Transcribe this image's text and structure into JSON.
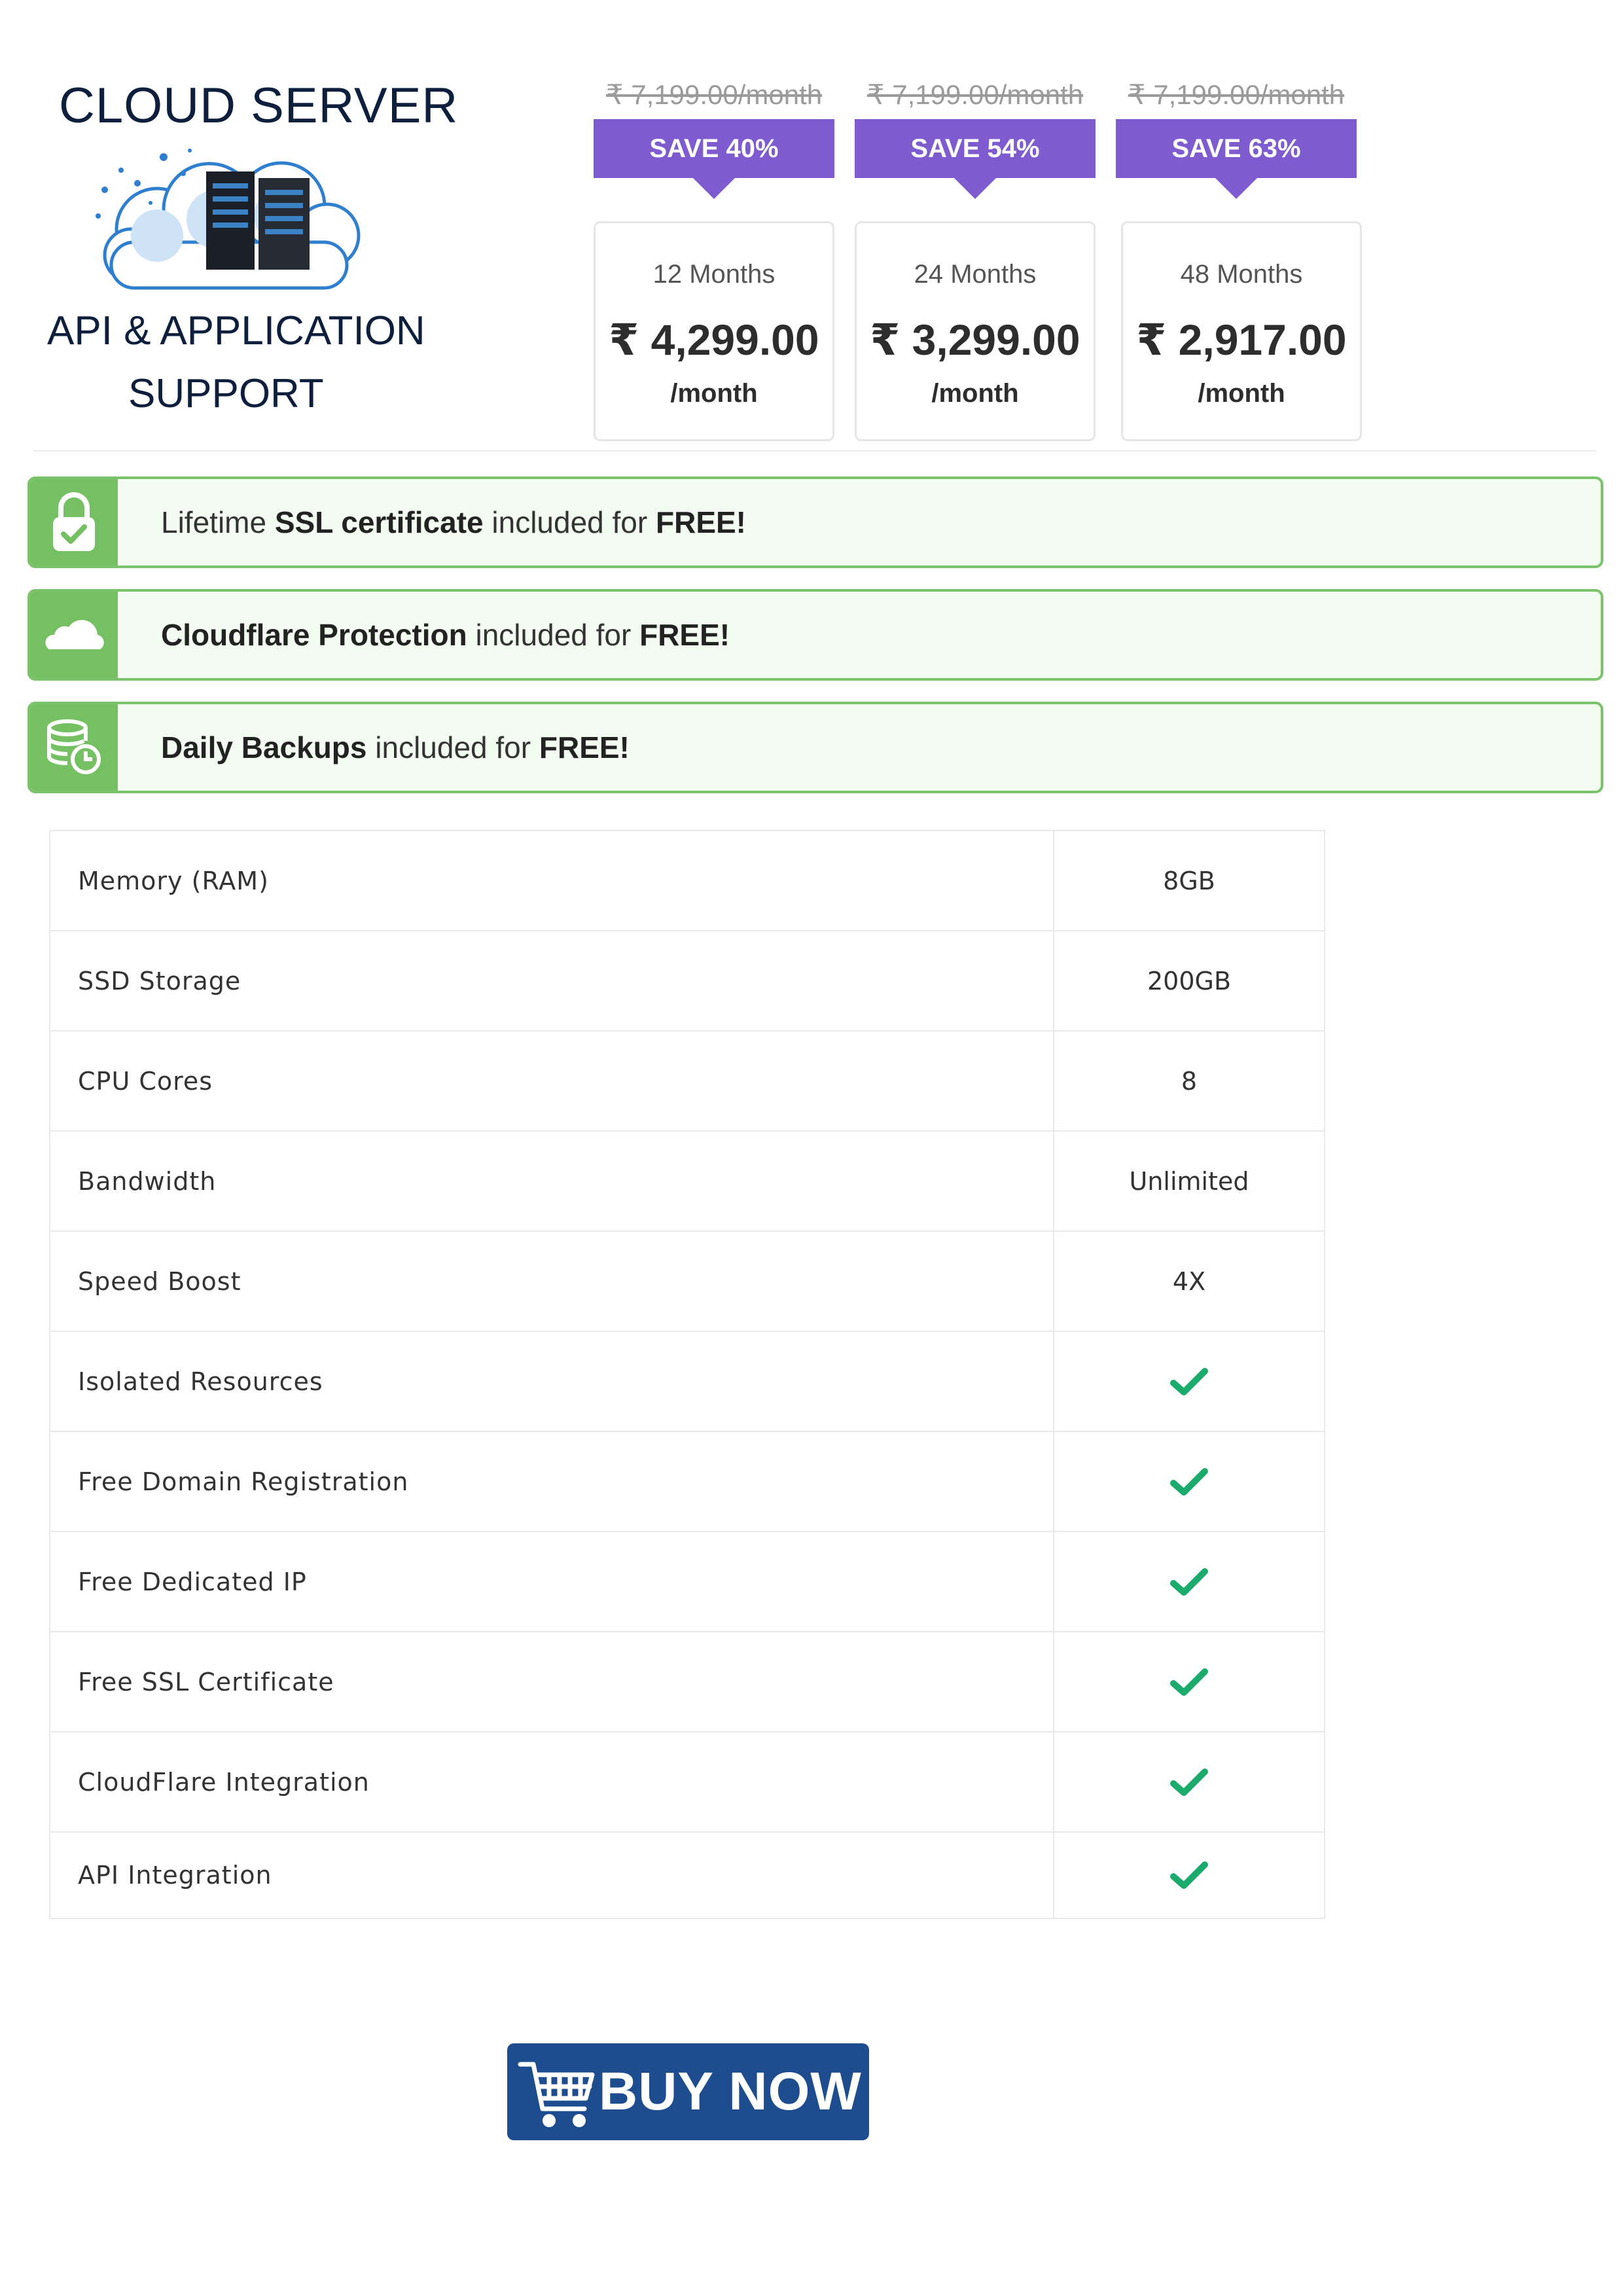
{
  "brand": {
    "title": "CLOUD SERVER",
    "subtitle_line1": "API & APPLICATION",
    "subtitle_line2": "SUPPORT",
    "logo_icon": "cloud-server-icon"
  },
  "plans": [
    {
      "old_price": "₹ 7,199.00/month",
      "save": "SAVE 40%",
      "months": "12 Months",
      "price": "₹ 4,299.00",
      "per": "/month"
    },
    {
      "old_price": "₹ 7,199.00/month",
      "save": "SAVE 54%",
      "months": "24 Months",
      "price": "₹ 3,299.00",
      "per": "/month"
    },
    {
      "old_price": "₹ 7,199.00/month",
      "save": "SAVE 63%",
      "months": "48 Months",
      "price": "₹ 2,917.00",
      "per": "/month"
    }
  ],
  "banners": [
    {
      "icon": "lock-check-icon",
      "parts": [
        "Lifetime ",
        "SSL certificate",
        " included for ",
        "FREE!"
      ]
    },
    {
      "icon": "cloud-icon",
      "parts": [
        "",
        "Cloudflare Protection",
        " included for ",
        "FREE!"
      ]
    },
    {
      "icon": "database-backup-icon",
      "parts": [
        "",
        "Daily Backups",
        " included for ",
        "FREE!"
      ]
    }
  ],
  "specs": [
    {
      "label": "Memory (RAM)",
      "value": "8GB"
    },
    {
      "label": "SSD Storage",
      "value": "200GB"
    },
    {
      "label": "CPU Cores",
      "value": "8"
    },
    {
      "label": "Bandwidth",
      "value": "Unlimited"
    },
    {
      "label": "Speed Boost",
      "value": "4X"
    },
    {
      "label": "Isolated Resources",
      "value": ""
    },
    {
      "label": "Free Domain Registration",
      "value": ""
    },
    {
      "label": "Free Dedicated IP",
      "value": ""
    },
    {
      "label": "Free SSL Certificate",
      "value": ""
    },
    {
      "label": "CloudFlare Integration",
      "value": ""
    },
    {
      "label": "API Integration",
      "value": ""
    }
  ],
  "buy": {
    "label": "BUY NOW",
    "icon": "shopping-cart-icon"
  },
  "colors": {
    "save_badge": "#7e5bcf",
    "banner_green": "#74c062",
    "check_green": "#1bab6c",
    "buy_blue": "#1e4d8f"
  }
}
